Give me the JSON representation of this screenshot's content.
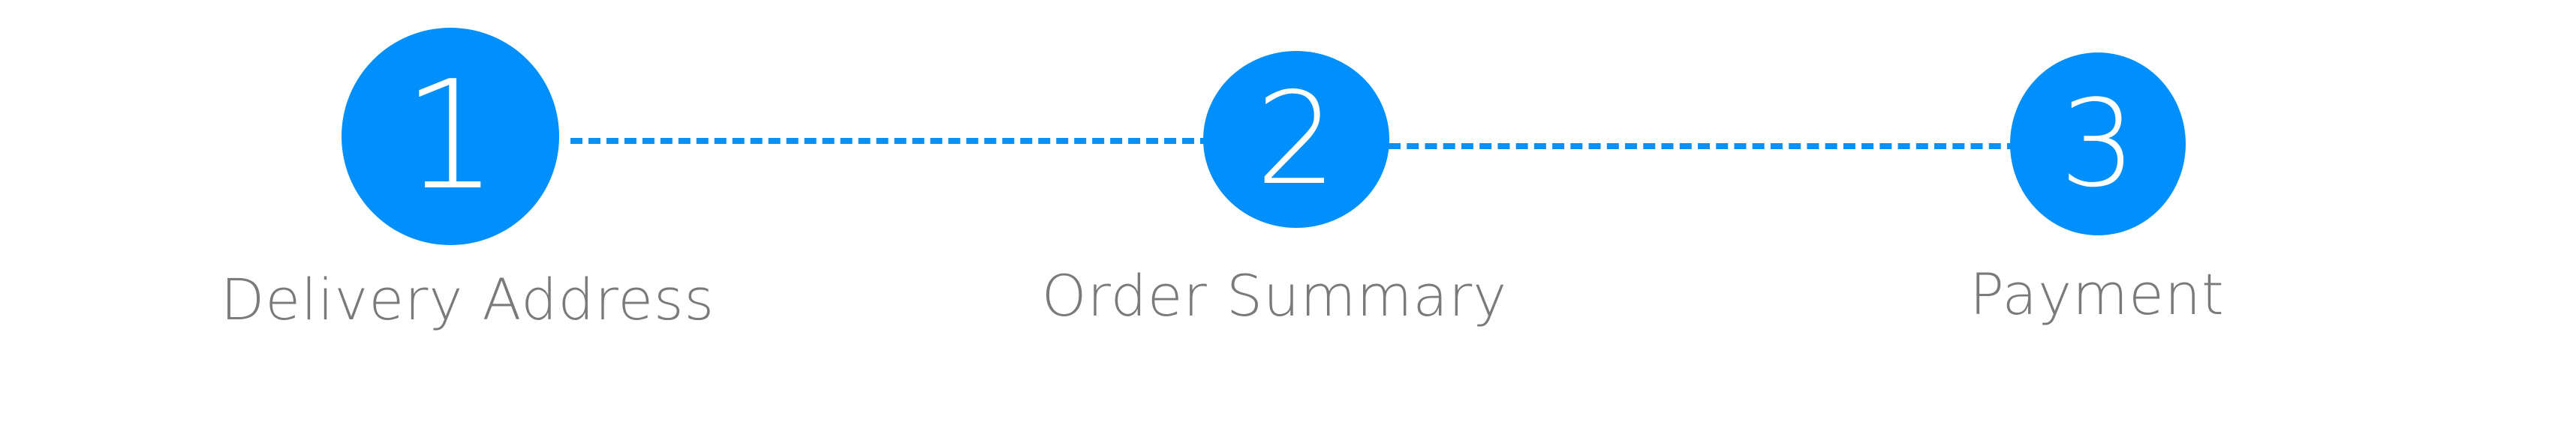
{
  "stepper": {
    "accent_color": "#008ffb",
    "label_color": "#7a7a7a",
    "steps": [
      {
        "number": "1",
        "label": "Delivery Address"
      },
      {
        "number": "2",
        "label": "Order Summary"
      },
      {
        "number": "3",
        "label": "Payment"
      }
    ]
  }
}
